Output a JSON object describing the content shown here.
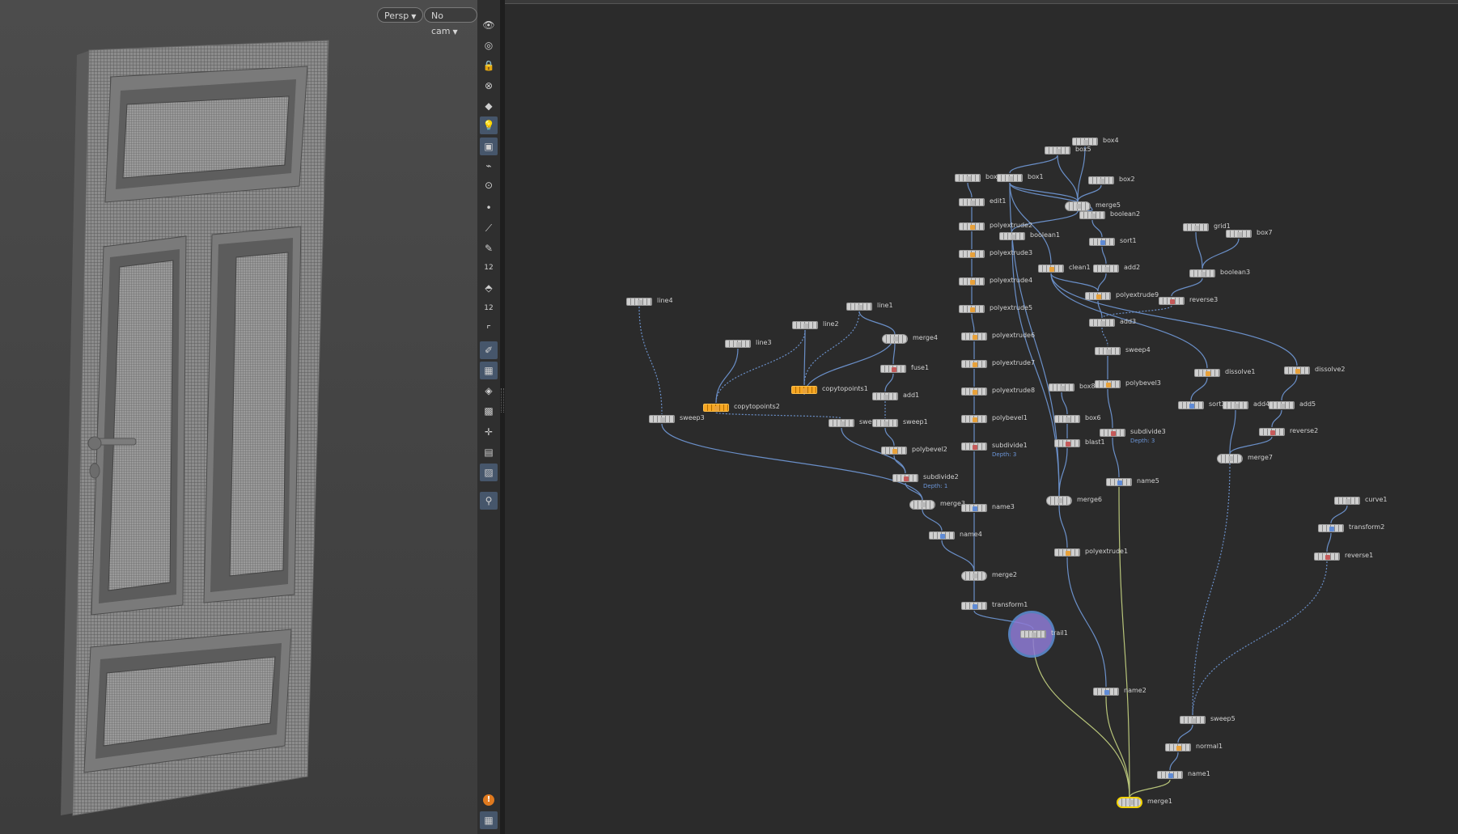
{
  "viewport": {
    "persp_label": "Persp",
    "cam_label": "No cam"
  },
  "toolbar": {
    "buttons": [
      {
        "icon": "visibility-icon",
        "active": false
      },
      {
        "icon": "ghost-icon",
        "active": false
      },
      {
        "icon": "lock-icon",
        "active": false
      },
      {
        "icon": "snap-icon",
        "active": false
      },
      {
        "icon": "pin-icon",
        "active": false
      },
      {
        "icon": "light-icon",
        "active": true
      },
      {
        "icon": "geometry-icon",
        "active": true
      },
      {
        "icon": "camera-icon",
        "active": false
      },
      {
        "icon": "camera-pivot-icon",
        "active": false
      },
      {
        "icon": "point-icon",
        "active": false
      },
      {
        "icon": "brush-icon",
        "active": false
      },
      {
        "icon": "pen-icon",
        "active": false
      },
      {
        "icon": "number-icon",
        "active": false,
        "text": "12"
      },
      {
        "icon": "paint-icon",
        "active": false
      },
      {
        "icon": "paint-number-icon",
        "active": false,
        "text": "12"
      },
      {
        "icon": "corner-icon",
        "active": false
      },
      {
        "icon": "sculpt-icon",
        "active": true
      },
      {
        "icon": "texture-icon",
        "active": true
      },
      {
        "icon": "layer-icon",
        "active": false
      },
      {
        "icon": "image-icon",
        "active": false
      },
      {
        "icon": "axis-icon",
        "active": false
      },
      {
        "icon": "display-icon",
        "active": false
      },
      {
        "icon": "background-icon",
        "active": true
      },
      {
        "icon": "pin-location-icon",
        "active": true
      },
      {
        "icon": "warning-icon",
        "active": false
      },
      {
        "icon": "grid-icon",
        "active": true
      }
    ]
  },
  "colors": {
    "sel": "#f6a623",
    "wire": "#6a8fc8",
    "green_wire": "#b8c57a",
    "display_flag": "#f2d200",
    "icon_orange": "#e8a13a",
    "icon_blue": "#5f8bd6",
    "icon_red": "#c55a5a",
    "icon_gray": "#b8b8b8"
  },
  "nodes": [
    {
      "id": "line4",
      "label": "line4",
      "icon": "#b8b8b8"
    },
    {
      "id": "line1",
      "label": "line1",
      "icon": "#b8b8b8"
    },
    {
      "id": "line2",
      "label": "line2",
      "icon": "#b8b8b8"
    },
    {
      "id": "line3",
      "label": "line3",
      "icon": "#b8b8b8"
    },
    {
      "id": "merge4",
      "label": "merge4",
      "icon": "#b8b8b8"
    },
    {
      "id": "fuse1",
      "label": "fuse1",
      "icon": "#c55a5a"
    },
    {
      "id": "copytopoints1",
      "label": "copytopoints1",
      "icon": "#e8a13a"
    },
    {
      "id": "copytopoints2",
      "label": "copytopoints2",
      "icon": "#e8a13a"
    },
    {
      "id": "add1",
      "label": "add1",
      "icon": "#b8b8b8"
    },
    {
      "id": "sweep3",
      "label": "sweep3",
      "icon": "#b8b8b8"
    },
    {
      "id": "sweep2",
      "label": "sweep2",
      "icon": "#b8b8b8"
    },
    {
      "id": "sweep1",
      "label": "sweep1",
      "icon": "#b8b8b8"
    },
    {
      "id": "polybevel2",
      "label": "polybevel2",
      "icon": "#e8a13a"
    },
    {
      "id": "subdivide2",
      "label": "subdivide2",
      "icon": "#c55a5a",
      "sub": "Depth: 1"
    },
    {
      "id": "merge3",
      "label": "merge3",
      "icon": "#b8b8b8"
    },
    {
      "id": "name4",
      "label": "name4",
      "icon": "#5f8bd6"
    },
    {
      "id": "box3",
      "label": "box3",
      "icon": "#b8b8b8"
    },
    {
      "id": "box1",
      "label": "box1",
      "icon": "#b8b8b8"
    },
    {
      "id": "box5",
      "label": "box5",
      "icon": "#b8b8b8"
    },
    {
      "id": "box4",
      "label": "box4",
      "icon": "#b8b8b8"
    },
    {
      "id": "box2",
      "label": "box2",
      "icon": "#b8b8b8"
    },
    {
      "id": "merge5",
      "label": "merge5",
      "icon": "#b8b8b8"
    },
    {
      "id": "boolean2",
      "label": "boolean2",
      "icon": "#b8b8b8"
    },
    {
      "id": "edit1",
      "label": "edit1",
      "icon": "#b8b8b8"
    },
    {
      "id": "polyextrude2",
      "label": "polyextrude2",
      "icon": "#e8a13a"
    },
    {
      "id": "boolean1",
      "label": "boolean1",
      "icon": "#b8b8b8"
    },
    {
      "id": "sort1",
      "label": "sort1",
      "icon": "#5f8bd6"
    },
    {
      "id": "polyextrude3",
      "label": "polyextrude3",
      "icon": "#e8a13a"
    },
    {
      "id": "clean1",
      "label": "clean1",
      "icon": "#e8a13a"
    },
    {
      "id": "add2",
      "label": "add2",
      "icon": "#b8b8b8"
    },
    {
      "id": "grid1",
      "label": "grid1",
      "icon": "#b8b8b8"
    },
    {
      "id": "box7",
      "label": "box7",
      "icon": "#b8b8b8"
    },
    {
      "id": "boolean3",
      "label": "boolean3",
      "icon": "#b8b8b8"
    },
    {
      "id": "polyextrude4",
      "label": "polyextrude4",
      "icon": "#e8a13a"
    },
    {
      "id": "polyextrude9",
      "label": "polyextrude9",
      "icon": "#e8a13a"
    },
    {
      "id": "reverse3",
      "label": "reverse3",
      "icon": "#c55a5a"
    },
    {
      "id": "polyextrude5",
      "label": "polyextrude5",
      "icon": "#e8a13a"
    },
    {
      "id": "add3",
      "label": "add3",
      "icon": "#b8b8b8"
    },
    {
      "id": "polyextrude6",
      "label": "polyextrude6",
      "icon": "#e8a13a"
    },
    {
      "id": "sweep4",
      "label": "sweep4",
      "icon": "#b8b8b8"
    },
    {
      "id": "polyextrude7",
      "label": "polyextrude7",
      "icon": "#e8a13a"
    },
    {
      "id": "dissolve1",
      "label": "dissolve1",
      "icon": "#e8a13a"
    },
    {
      "id": "dissolve2",
      "label": "dissolve2",
      "icon": "#e8a13a"
    },
    {
      "id": "polybevel3",
      "label": "polybevel3",
      "icon": "#e8a13a"
    },
    {
      "id": "box8",
      "label": "box8",
      "icon": "#b8b8b8"
    },
    {
      "id": "polyextrude8",
      "label": "polyextrude8",
      "icon": "#e8a13a"
    },
    {
      "id": "sort2",
      "label": "sort2",
      "icon": "#5f8bd6"
    },
    {
      "id": "add4",
      "label": "add4",
      "icon": "#b8b8b8"
    },
    {
      "id": "add5",
      "label": "add5",
      "icon": "#b8b8b8"
    },
    {
      "id": "box6",
      "label": "box6",
      "icon": "#b8b8b8"
    },
    {
      "id": "polybevel1",
      "label": "polybevel1",
      "icon": "#e8a13a"
    },
    {
      "id": "subdivide3",
      "label": "subdivide3",
      "icon": "#c55a5a",
      "sub": "Depth: 3"
    },
    {
      "id": "reverse2",
      "label": "reverse2",
      "icon": "#c55a5a"
    },
    {
      "id": "blast1",
      "label": "blast1",
      "icon": "#c55a5a"
    },
    {
      "id": "subdivide1",
      "label": "subdivide1",
      "icon": "#c55a5a",
      "sub": "Depth: 3"
    },
    {
      "id": "merge7",
      "label": "merge7",
      "icon": "#b8b8b8"
    },
    {
      "id": "name5",
      "label": "name5",
      "icon": "#5f8bd6"
    },
    {
      "id": "merge6",
      "label": "merge6",
      "icon": "#b8b8b8"
    },
    {
      "id": "curve1",
      "label": "curve1",
      "icon": "#b8b8b8"
    },
    {
      "id": "name3",
      "label": "name3",
      "icon": "#5f8bd6"
    },
    {
      "id": "transform2",
      "label": "transform2",
      "icon": "#5f8bd6"
    },
    {
      "id": "polyextrude1",
      "label": "polyextrude1",
      "icon": "#e8a13a"
    },
    {
      "id": "reverse1",
      "label": "reverse1",
      "icon": "#c55a5a"
    },
    {
      "id": "merge2",
      "label": "merge2",
      "icon": "#b8b8b8"
    },
    {
      "id": "transform1",
      "label": "transform1",
      "icon": "#5f8bd6"
    },
    {
      "id": "trail1",
      "label": "trail1",
      "icon": "#b8b8b8"
    },
    {
      "id": "name2",
      "label": "name2",
      "icon": "#5f8bd6"
    },
    {
      "id": "sweep5",
      "label": "sweep5",
      "icon": "#b8b8b8"
    },
    {
      "id": "normal1",
      "label": "normal1",
      "icon": "#e8a13a"
    },
    {
      "id": "name1",
      "label": "name1",
      "icon": "#5f8bd6"
    },
    {
      "id": "merge1",
      "label": "merge1",
      "icon": "#b8b8b8"
    }
  ],
  "connections": [
    [
      "line4",
      "sweep3",
      "dashed"
    ],
    [
      "line3",
      "copytopoints2",
      "solid"
    ],
    [
      "line2",
      "copytopoints2",
      "dashed"
    ],
    [
      "line2",
      "copytopoints1",
      "solid"
    ],
    [
      "line1",
      "copytopoints1",
      "dashed"
    ],
    [
      "line1",
      "merge4",
      "solid"
    ],
    [
      "copytopoints1",
      "merge4",
      "solid"
    ],
    [
      "merge4",
      "fuse1",
      "solid"
    ],
    [
      "fuse1",
      "add1",
      "solid"
    ],
    [
      "add1",
      "sweep1",
      "dashed"
    ],
    [
      "copytopoints2",
      "sweep2",
      "dashed"
    ],
    [
      "sweep2",
      "subdivide2",
      "solid"
    ],
    [
      "sweep1",
      "polybevel2",
      "solid"
    ],
    [
      "polybevel2",
      "subdivide2",
      "solid"
    ],
    [
      "sweep3",
      "merge3",
      "solid"
    ],
    [
      "subdivide2",
      "merge3",
      "solid"
    ],
    [
      "merge3",
      "name4",
      "solid"
    ],
    [
      "name4",
      "merge2",
      "solid"
    ],
    [
      "box3",
      "edit1",
      "solid"
    ],
    [
      "edit1",
      "polyextrude2",
      "solid"
    ],
    [
      "polyextrude2",
      "polyextrude3",
      "solid"
    ],
    [
      "polyextrude3",
      "polyextrude4",
      "solid"
    ],
    [
      "polyextrude4",
      "polyextrude5",
      "solid"
    ],
    [
      "polyextrude5",
      "polyextrude6",
      "solid"
    ],
    [
      "polyextrude6",
      "polyextrude7",
      "solid"
    ],
    [
      "polyextrude7",
      "polyextrude8",
      "solid"
    ],
    [
      "polyextrude8",
      "polybevel1",
      "solid"
    ],
    [
      "polybevel1",
      "subdivide1",
      "solid"
    ],
    [
      "subdivide1",
      "name3",
      "solid"
    ],
    [
      "name3",
      "merge2",
      "solid"
    ],
    [
      "merge2",
      "transform1",
      "solid"
    ],
    [
      "transform1",
      "trail1",
      "solid"
    ],
    [
      "box5",
      "merge5",
      "solid"
    ],
    [
      "box4",
      "merge5",
      "solid"
    ],
    [
      "box2",
      "merge5",
      "solid"
    ],
    [
      "box1",
      "merge5",
      "solid"
    ],
    [
      "merge5",
      "boolean2",
      "solid"
    ],
    [
      "box1",
      "boolean2",
      "solid"
    ],
    [
      "boolean2",
      "sort1",
      "solid"
    ],
    [
      "sort1",
      "add2",
      "solid"
    ],
    [
      "add2",
      "polyextrude9",
      "solid"
    ],
    [
      "merge5",
      "boolean1",
      "solid"
    ],
    [
      "boolean1",
      "merge6",
      "solid"
    ],
    [
      "box1",
      "clean1",
      "solid"
    ],
    [
      "clean1",
      "polyextrude9",
      "solid"
    ],
    [
      "polyextrude9",
      "add3",
      "solid"
    ],
    [
      "add3",
      "sweep4",
      "dashed"
    ],
    [
      "sweep4",
      "polybevel3",
      "solid"
    ],
    [
      "polybevel3",
      "subdivide3",
      "solid"
    ],
    [
      "subdivide3",
      "name5",
      "solid"
    ],
    [
      "clean1",
      "dissolve1",
      "solid"
    ],
    [
      "clean1",
      "dissolve2",
      "solid"
    ],
    [
      "dissolve1",
      "sort2",
      "solid"
    ],
    [
      "dissolve2",
      "add5",
      "solid"
    ],
    [
      "add5",
      "reverse2",
      "solid"
    ],
    [
      "reverse2",
      "merge7",
      "solid"
    ],
    [
      "add4",
      "merge7",
      "solid"
    ],
    [
      "grid1",
      "boolean3",
      "solid"
    ],
    [
      "box7",
      "boolean3",
      "solid"
    ],
    [
      "boolean3",
      "reverse3",
      "solid"
    ],
    [
      "reverse3",
      "add3",
      "dashed"
    ],
    [
      "box8",
      "box6",
      "solid"
    ],
    [
      "box6",
      "blast1",
      "solid"
    ],
    [
      "blast1",
      "merge6",
      "solid"
    ],
    [
      "merge6",
      "polyextrude1",
      "solid"
    ],
    [
      "polyextrude1",
      "name2",
      "solid"
    ],
    [
      "name2",
      "merge1",
      "green"
    ],
    [
      "name5",
      "merge1",
      "green"
    ],
    [
      "trail1",
      "merge1",
      "green"
    ],
    [
      "merge7",
      "sweep5",
      "dashed"
    ],
    [
      "curve1",
      "transform2",
      "solid"
    ],
    [
      "transform2",
      "reverse1",
      "solid"
    ],
    [
      "reverse1",
      "sweep5",
      "dashed"
    ],
    [
      "sweep5",
      "normal1",
      "solid"
    ],
    [
      "normal1",
      "name1",
      "solid"
    ],
    [
      "name1",
      "merge1",
      "green"
    ],
    [
      "box1",
      "merge6",
      "solid"
    ],
    [
      "box5",
      "box1",
      "solid"
    ]
  ]
}
